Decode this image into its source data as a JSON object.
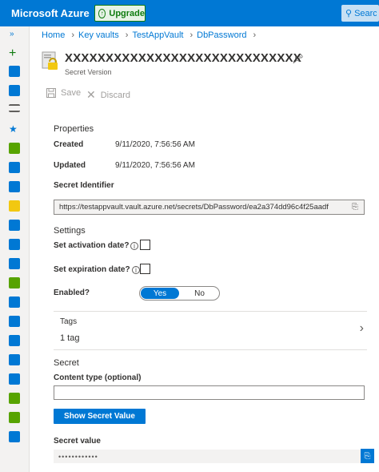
{
  "topbar": {
    "brand": "Microsoft Azure",
    "upgrade_label": "Upgrade",
    "search_label": "Search"
  },
  "sidebar": {
    "collapse_glyph": "»",
    "icons": [
      {
        "name": "create-resource-icon",
        "color": "#107c10"
      },
      {
        "name": "home-icon",
        "color": "#0078d4"
      },
      {
        "name": "dashboard-icon",
        "color": "#0078d4"
      },
      {
        "name": "all-services-icon",
        "color": "#605e5c"
      },
      {
        "name": "favorites-star-icon",
        "color": "#0078d4"
      },
      {
        "name": "all-resources-icon",
        "color": "#57a300"
      },
      {
        "name": "resource-groups-icon",
        "color": "#0078d4"
      },
      {
        "name": "app-services-icon",
        "color": "#0078d4"
      },
      {
        "name": "function-app-icon",
        "color": "#f2c811"
      },
      {
        "name": "sql-databases-icon",
        "color": "#0078d4"
      },
      {
        "name": "cosmos-db-icon",
        "color": "#0078d4"
      },
      {
        "name": "virtual-machines-icon",
        "color": "#0078d4"
      },
      {
        "name": "load-balancers-icon",
        "color": "#57a300"
      },
      {
        "name": "storage-accounts-icon",
        "color": "#0078d4"
      },
      {
        "name": "virtual-networks-icon",
        "color": "#0078d4"
      },
      {
        "name": "azure-ad-icon",
        "color": "#0078d4"
      },
      {
        "name": "monitor-icon",
        "color": "#0078d4"
      },
      {
        "name": "advisor-icon",
        "color": "#0078d4"
      },
      {
        "name": "security-center-icon",
        "color": "#57a300"
      },
      {
        "name": "cost-management-icon",
        "color": "#57a300"
      },
      {
        "name": "help-support-icon",
        "color": "#0078d4"
      }
    ]
  },
  "breadcrumb": {
    "items": [
      "Home",
      "Key vaults",
      "TestAppVault",
      "DbPassword"
    ]
  },
  "header": {
    "title": "XXXXXXXXXXXXXXXXXXXXXXXXXXXXX",
    "subtitle": "Secret Version"
  },
  "toolbar": {
    "save_label": "Save",
    "discard_label": "Discard"
  },
  "properties": {
    "heading": "Properties",
    "created_label": "Created",
    "created_value": "9/11/2020, 7:56:56 AM",
    "updated_label": "Updated",
    "updated_value": "9/11/2020, 7:56:56 AM",
    "identifier_label": "Secret Identifier",
    "identifier_value": "https://testappvault.vault.azure.net/secrets/DbPassword/ea2a374dd96c4f25aadf"
  },
  "settings": {
    "heading": "Settings",
    "activation_label": "Set activation date?",
    "expiration_label": "Set expiration date?",
    "enabled_label": "Enabled?",
    "enabled_yes": "Yes",
    "enabled_no": "No"
  },
  "tags": {
    "label": "Tags",
    "value": "1 tag"
  },
  "secret": {
    "heading": "Secret",
    "content_type_label": "Content type (optional)",
    "show_button": "Show Secret Value",
    "value_label": "Secret value",
    "masked_value": "••••••••••••"
  }
}
